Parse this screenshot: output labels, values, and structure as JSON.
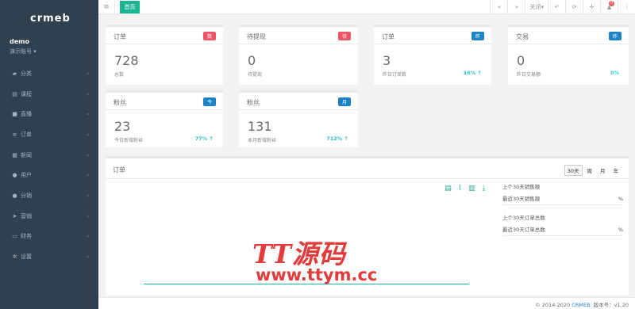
{
  "sidebar": {
    "logo": "crmeb",
    "user": {
      "name": "demo",
      "role": "演示账号"
    },
    "items": [
      {
        "label": "分类",
        "icon": "gift-icon"
      },
      {
        "label": "课程",
        "icon": "book-icon"
      },
      {
        "label": "直播",
        "icon": "video-icon"
      },
      {
        "label": "订单",
        "icon": "list-icon"
      },
      {
        "label": "新闻",
        "icon": "newspaper-icon"
      },
      {
        "label": "用户",
        "icon": "user-icon"
      },
      {
        "label": "分销",
        "icon": "users-icon"
      },
      {
        "label": "营销",
        "icon": "send-icon"
      },
      {
        "label": "财务",
        "icon": "money-icon"
      },
      {
        "label": "设置",
        "icon": "gear-icon"
      }
    ]
  },
  "topbar": {
    "home_tab": "首页",
    "close_label": "关闭"
  },
  "cards": [
    {
      "title": "订单",
      "pill": "数",
      "pill_color": "#ed5565",
      "value": "728",
      "sub": "总数",
      "pct": ""
    },
    {
      "title": "待提现",
      "pill": "待",
      "pill_color": "#ed5565",
      "value": "0",
      "sub": "待提现",
      "pct": ""
    },
    {
      "title": "订单",
      "pill": "昨",
      "pill_color": "#1c84c6",
      "value": "3",
      "sub": "昨日订单数",
      "pct": "16% ↑"
    },
    {
      "title": "交易",
      "pill": "昨",
      "pill_color": "#1c84c6",
      "value": "0",
      "sub": "昨日交易额",
      "pct": "0%"
    },
    {
      "title": "粉丝",
      "pill": "今",
      "pill_color": "#1c84c6",
      "value": "23",
      "sub": "今日新增粉丝",
      "pct": "77% ↑"
    },
    {
      "title": "粉丝",
      "pill": "月",
      "pill_color": "#1c84c6",
      "value": "131",
      "sub": "本月新增粉丝",
      "pct": "712% ↑"
    }
  ],
  "orders": {
    "title": "订单",
    "periods": [
      "30天",
      "周",
      "月",
      "年"
    ],
    "active_period": "30天",
    "stats": {
      "sales_heading": "上个30天销售额",
      "sales_label": "最近30天销售额",
      "sales_unit": "%",
      "orders_heading": "上个30天订单总数",
      "orders_label": "最近30天订单总数",
      "orders_unit": "%"
    }
  },
  "watermark": {
    "cn": "TT源码",
    "url": "www.ttym.cc"
  },
  "footer": {
    "copyright": "© 2014-2020",
    "brand": "CRMEB",
    "version": "版本号：v1.20"
  },
  "colors": {
    "sidebar": "#2f4050",
    "accent": "#1ab394",
    "red": "#ed5565",
    "blue": "#1c84c6",
    "watermark": "#e63a3a"
  }
}
